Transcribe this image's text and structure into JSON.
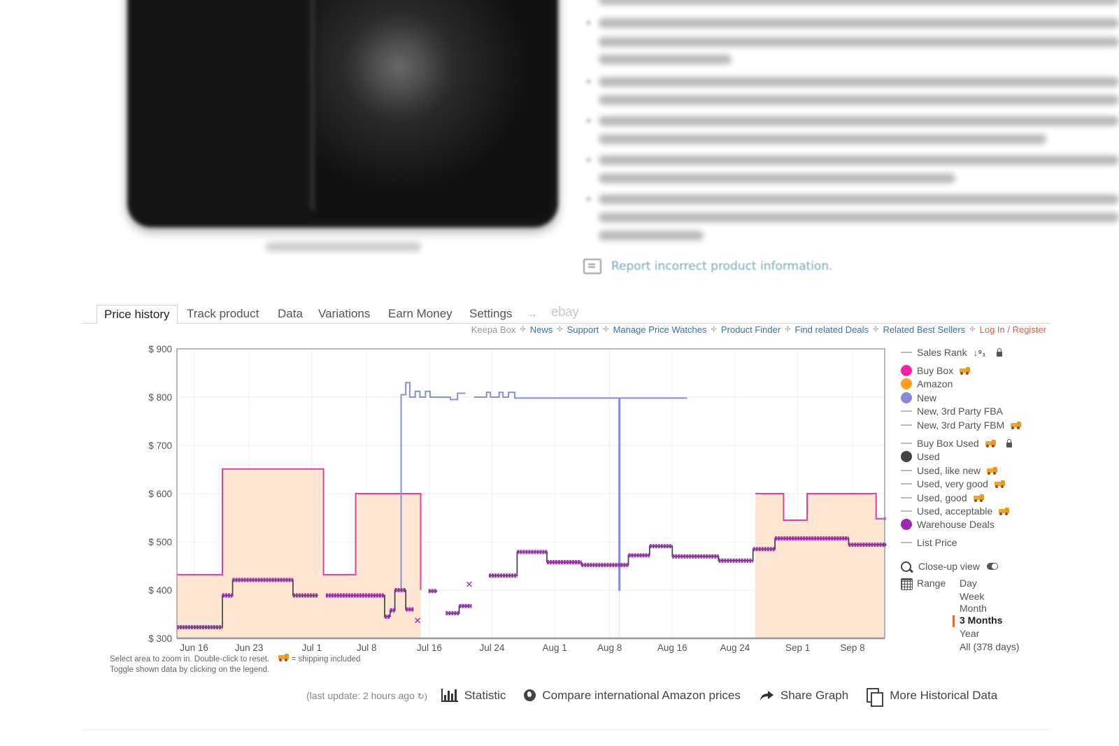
{
  "product_area": {
    "report_link": "Report incorrect product information.",
    "blurred_bullet_count": 5
  },
  "tabs": {
    "items": [
      {
        "label": "Price history",
        "active": true
      },
      {
        "label": "Track product",
        "active": false
      },
      {
        "label": "Data",
        "active": false
      },
      {
        "label": "Variations",
        "active": false
      },
      {
        "label": "Earn Money",
        "active": false
      },
      {
        "label": "Settings",
        "active": false
      }
    ],
    "arrow": "→",
    "ebay": "ebay"
  },
  "subnav": {
    "keepa_box": "Keepa Box",
    "links": [
      "News",
      "Support",
      "Manage Price Watches",
      "Product Finder",
      "Find related Deals",
      "Related Best Sellers"
    ],
    "login": "Log In / Register",
    "separator": "✣"
  },
  "chart_note": {
    "line1": "Select area to zoom in. Double-click to reset.",
    "shipping_note": "= shipping included",
    "line2": "Toggle shown data by clicking on the legend."
  },
  "legend": {
    "items": [
      {
        "label": "Sales Rank",
        "marker": "line",
        "color": "#bbbbbb",
        "sort_icon": true,
        "locked": true
      },
      {
        "label": "Buy Box",
        "marker": "dot",
        "color": "#ff1fa5",
        "shipping": true
      },
      {
        "label": "Amazon",
        "marker": "dot",
        "color": "#ff9f1c"
      },
      {
        "label": "New",
        "marker": "dot",
        "color": "#8888dd"
      },
      {
        "label": "New, 3rd Party FBA",
        "marker": "line",
        "color": "#bbbbbb"
      },
      {
        "label": "New, 3rd Party FBM",
        "marker": "line",
        "color": "#bbbbbb",
        "shipping": true
      },
      {
        "label": "Buy Box Used",
        "marker": "line",
        "color": "#bbbbbb",
        "shipping": true,
        "locked": true
      },
      {
        "label": "Used",
        "marker": "dot",
        "color": "#444444"
      },
      {
        "label": "Used, like new",
        "marker": "line",
        "color": "#bbbbbb",
        "shipping": true
      },
      {
        "label": "Used, very good",
        "marker": "line",
        "color": "#bbbbbb",
        "shipping": true
      },
      {
        "label": "Used, good",
        "marker": "line",
        "color": "#bbbbbb",
        "shipping": true
      },
      {
        "label": "Used, acceptable",
        "marker": "line",
        "color": "#bbbbbb",
        "shipping": true
      },
      {
        "label": "Warehouse Deals",
        "marker": "dot",
        "color": "#9c27b0"
      },
      {
        "label": "List Price",
        "marker": "line",
        "color": "#bbbbbb"
      }
    ],
    "closeup_label": "Close-up view",
    "range_label": "Range",
    "range_options": [
      "Day",
      "Week",
      "Month",
      "3 Months",
      "Year",
      "All (378 days)"
    ],
    "range_selected": "3 Months"
  },
  "toolbar": {
    "last_update": "(last update: 2 hours ago",
    "statistic": "Statistic",
    "compare": "Compare international Amazon prices",
    "share": "Share Graph",
    "more": "More Historical Data"
  },
  "chart_data": {
    "type": "line",
    "title": "",
    "xlabel": "",
    "ylabel": "",
    "y_prefix": "$ ",
    "ylim": [
      300,
      900
    ],
    "yticks": [
      300,
      400,
      500,
      600,
      700,
      800,
      900
    ],
    "x_unit": "days since Jun 16",
    "xlim": [
      -2.2,
      88.1
    ],
    "xticks": [
      {
        "day": 0,
        "label": "Jun 16"
      },
      {
        "day": 7,
        "label": "Jun 23"
      },
      {
        "day": 15,
        "label": "Jul 1"
      },
      {
        "day": 22,
        "label": "Jul 8"
      },
      {
        "day": 30,
        "label": "Jul 16"
      },
      {
        "day": 38,
        "label": "Jul 24"
      },
      {
        "day": 46,
        "label": "Aug 1"
      },
      {
        "day": 53,
        "label": "Aug 8"
      },
      {
        "day": 61,
        "label": "Aug 16"
      },
      {
        "day": 69,
        "label": "Aug 24"
      },
      {
        "day": 77,
        "label": "Sep 1"
      },
      {
        "day": 84,
        "label": "Sep 8"
      }
    ],
    "grid": true,
    "legend_position": "right",
    "series": [
      {
        "name": "Buy Box",
        "color": "#e83e9c",
        "step": true,
        "segments": [
          [
            [
              -2.2,
              432
            ],
            [
              3.6,
              432
            ],
            [
              3.6,
              651
            ],
            [
              16.5,
              651
            ],
            [
              16.5,
              432
            ],
            [
              20.6,
              432
            ],
            [
              20.6,
              600
            ],
            [
              28.9,
              600
            ],
            [
              28.9,
              400
            ],
            [
              28.9,
              400
            ]
          ],
          [
            [
              71.6,
              600
            ],
            [
              75.2,
              600
            ],
            [
              75.2,
              545
            ],
            [
              78.2,
              545
            ],
            [
              78.2,
              600
            ],
            [
              87.0,
              600
            ],
            [
              87.0,
              548
            ],
            [
              88.1,
              548
            ]
          ]
        ]
      },
      {
        "name": "Amazon (shaded area)",
        "color": "#fde6d2",
        "area": true,
        "segments": [
          [
            [
              -2.2,
              900
            ],
            [
              26.1,
              900
            ]
          ],
          [
            [
              71.6,
              900
            ],
            [
              88.1,
              900
            ]
          ]
        ],
        "note": "Out-of-stock/available shading spans Jun 14–Jul 11 and Aug 26–Sep 13"
      },
      {
        "name": "New",
        "color": "#8a8ee0",
        "step": true,
        "segments": [
          [
            [
              26.4,
              400
            ],
            [
              26.4,
              805
            ],
            [
              27.0,
              805
            ],
            [
              27.0,
              830
            ],
            [
              27.5,
              830
            ],
            [
              27.5,
              800
            ],
            [
              28.2,
              800
            ],
            [
              28.2,
              812
            ],
            [
              28.8,
              812
            ],
            [
              28.8,
              800
            ],
            [
              29.5,
              800
            ],
            [
              29.5,
              812
            ],
            [
              30.1,
              812
            ],
            [
              30.1,
              800
            ],
            [
              32.7,
              800
            ],
            [
              32.7,
              795
            ],
            [
              33.6,
              795
            ],
            [
              33.6,
              808
            ],
            [
              34.6,
              808
            ]
          ],
          [
            [
              35.7,
              800
            ],
            [
              37.3,
              800
            ],
            [
              37.3,
              810
            ],
            [
              37.8,
              810
            ],
            [
              37.8,
              800
            ],
            [
              38.9,
              800
            ],
            [
              38.9,
              810
            ],
            [
              39.4,
              810
            ],
            [
              39.4,
              800
            ],
            [
              40.1,
              800
            ],
            [
              40.1,
              810
            ],
            [
              40.9,
              810
            ],
            [
              40.9,
              798
            ],
            [
              54.2,
              798
            ],
            [
              54.2,
              400
            ],
            [
              54.3,
              400
            ],
            [
              54.3,
              798
            ],
            [
              62.9,
              798
            ]
          ]
        ]
      },
      {
        "name": "Warehouse Deals",
        "color": "#9c27b0",
        "marker": "x",
        "step": true,
        "segments": [
          [
            [
              -2.2,
              323
            ],
            [
              3.6,
              323
            ],
            [
              3.6,
              389
            ],
            [
              4.9,
              389
            ],
            [
              4.9,
              421
            ],
            [
              12.6,
              421
            ],
            [
              12.6,
              389
            ],
            [
              15.8,
              389
            ]
          ],
          [
            [
              16.8,
              389
            ],
            [
              24.3,
              389
            ],
            [
              24.3,
              345
            ],
            [
              25.0,
              345
            ],
            [
              25.0,
              358
            ],
            [
              25.6,
              358
            ],
            [
              25.6,
              400
            ],
            [
              27.0,
              400
            ],
            [
              27.0,
              360
            ],
            [
              28.0,
              360
            ]
          ],
          [
            [
              29.9,
              398
            ],
            [
              31.0,
              398
            ]
          ],
          [
            [
              32.1,
              352
            ],
            [
              33.8,
              352
            ],
            [
              33.8,
              367
            ],
            [
              35.4,
              367
            ]
          ],
          [
            [
              37.6,
              430
            ],
            [
              41.2,
              430
            ],
            [
              41.2,
              479
            ],
            [
              45.0,
              479
            ],
            [
              45.0,
              458
            ],
            [
              49.4,
              458
            ],
            [
              49.4,
              452
            ],
            [
              55.4,
              452
            ],
            [
              55.4,
              472
            ],
            [
              58.1,
              472
            ],
            [
              58.1,
              491
            ],
            [
              61.0,
              491
            ],
            [
              61.0,
              470
            ],
            [
              66.9,
              470
            ],
            [
              66.9,
              461
            ],
            [
              71.3,
              461
            ],
            [
              71.3,
              485
            ],
            [
              74.1,
              485
            ],
            [
              74.1,
              507
            ],
            [
              83.5,
              507
            ],
            [
              83.5,
              494
            ],
            [
              88.1,
              494
            ]
          ]
        ],
        "isolated_points": [
          [
            28.5,
            337
          ],
          [
            35.1,
            412
          ]
        ]
      }
    ]
  }
}
